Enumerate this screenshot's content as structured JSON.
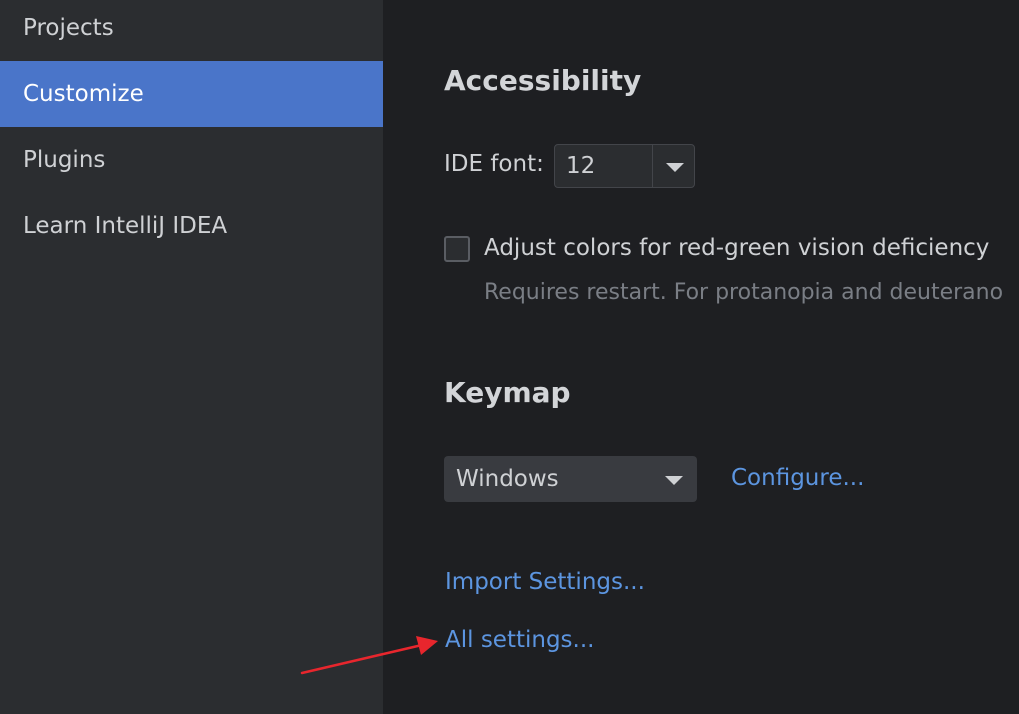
{
  "sidebar": {
    "items": [
      {
        "label": "Projects"
      },
      {
        "label": "Customize",
        "selected": true
      },
      {
        "label": "Plugins"
      },
      {
        "label": "Learn IntelliJ IDEA"
      }
    ]
  },
  "accessibility": {
    "title": "Accessibility",
    "ide_font_label": "IDE font:",
    "ide_font_value": "12",
    "color_adjust_checkbox": {
      "label": "Adjust colors for red-green vision deficiency",
      "checked": false,
      "hint": "Requires restart. For protanopia and deuterano"
    }
  },
  "keymap": {
    "title": "Keymap",
    "selected": "Windows",
    "configure_link": "Configure..."
  },
  "links": {
    "import_settings": "Import Settings...",
    "all_settings": "All settings..."
  },
  "annotation": {
    "arrow_color": "#e8262d",
    "points_to": "All settings..."
  },
  "colors": {
    "sidebar_bg": "#2b2d30",
    "main_bg": "#1e1f22",
    "selection": "#4a75c9",
    "link": "#5c95e0"
  }
}
